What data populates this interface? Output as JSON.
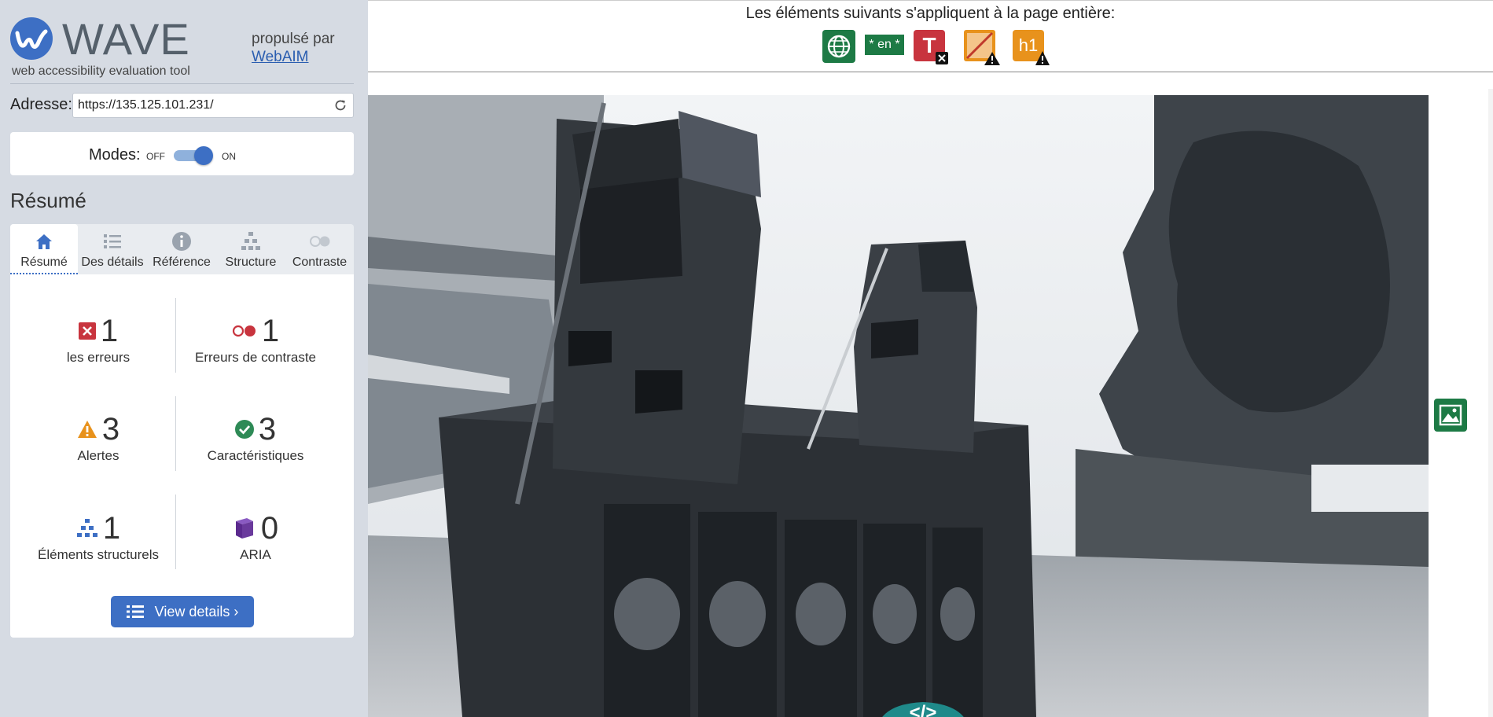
{
  "sidebar": {
    "logo_text": "WAVE",
    "logo_tagline": "web accessibility evaluation tool",
    "powered_by": "propulsé par",
    "powered_link": "WebAIM",
    "address_label": "Adresse:",
    "address_value": "https://135.125.101.231/",
    "modes_label": "Modes:",
    "modes_off": "OFF",
    "modes_on": "ON",
    "modes_state": "on",
    "section_title": "Résumé",
    "tabs": [
      {
        "label": "Résumé",
        "icon": "home-icon",
        "active": true
      },
      {
        "label": "Des détails",
        "icon": "list-icon",
        "active": false
      },
      {
        "label": "Référence",
        "icon": "info-icon",
        "active": false
      },
      {
        "label": "Structure",
        "icon": "structure-icon",
        "active": false
      },
      {
        "label": "Contraste",
        "icon": "contrast-icon",
        "active": false
      }
    ],
    "stats": [
      {
        "count": "1",
        "label": "les erreurs",
        "icon": "error-icon",
        "color": "#c8343e"
      },
      {
        "count": "1",
        "label": "Erreurs de contraste",
        "icon": "contrast-error-icon",
        "color": "#c8343e"
      },
      {
        "count": "3",
        "label": "Alertes",
        "icon": "alert-icon",
        "color": "#e8921c"
      },
      {
        "count": "3",
        "label": "Caractéristiques",
        "icon": "feature-icon",
        "color": "#2e8a56"
      },
      {
        "count": "1",
        "label": "Éléments structurels",
        "icon": "structure-icon",
        "color": "#3d6fc4"
      },
      {
        "count": "0",
        "label": "ARIA",
        "icon": "aria-icon",
        "color": "#6a3a9c"
      }
    ],
    "view_details": "View details ›"
  },
  "topbar": {
    "text": "Les éléments suivants s'appliquent à la page entière:",
    "page_icons": [
      {
        "name": "language-globe-icon",
        "type": "feature"
      },
      {
        "name": "language-en-icon",
        "label": "* en *",
        "type": "feature"
      },
      {
        "name": "missing-title-icon",
        "label": "T",
        "type": "error"
      },
      {
        "name": "no-heading-structure-icon",
        "type": "alert"
      },
      {
        "name": "missing-h1-icon",
        "label": "h1",
        "type": "alert"
      }
    ]
  },
  "content": {
    "photo_icon": "image-feature-icon",
    "code_badge": "</>"
  },
  "colors": {
    "accent": "#3d6fc4",
    "sidebar_bg": "#d6dbe3",
    "feature_green": "#1d7a45",
    "error_red": "#c8343e",
    "alert_orange": "#e8921c"
  }
}
